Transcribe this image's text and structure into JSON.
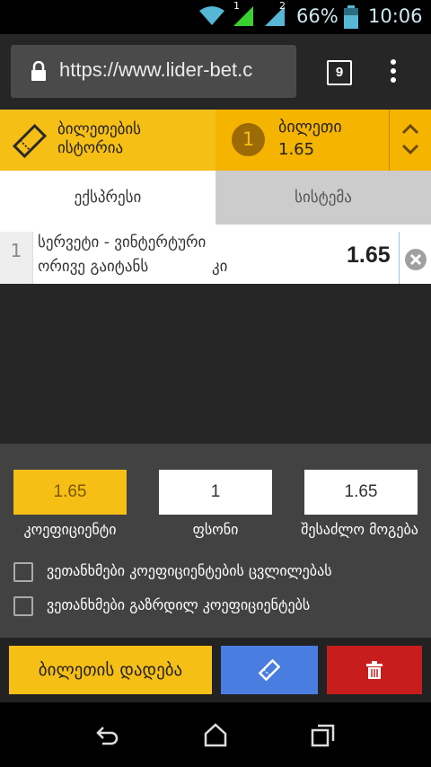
{
  "status_bar": {
    "battery_percent": "66%",
    "time": "10:06",
    "signal_1_label": "1",
    "signal_2_label": "2"
  },
  "browser": {
    "url": "https://www.lider-bet.c",
    "tab_count": "9"
  },
  "header": {
    "history_label": "ბილეთების ისტორია",
    "ticket_count": "1",
    "ticket_title": "ბილეთი",
    "ticket_odds": "1.65"
  },
  "tabs": {
    "express": "ექსპრესი",
    "system": "სისტემა"
  },
  "selection": {
    "index": "1",
    "event": "სერვეტი - ვინტერტური",
    "market": "ორივე გაიტანს",
    "outcome": "კი",
    "odds": "1.65"
  },
  "calculator": {
    "coefficient_value": "1.65",
    "coefficient_label": "კოეფიციენტი",
    "stake_value": "1",
    "stake_label": "ფსონი",
    "possible_win_value": "1.65",
    "possible_win_label": "შესაძლო მოგება",
    "accept_changes_label": "ვეთანხმები კოეფიციენტების ცვლილებას",
    "accept_increased_label": "ვეთანხმები გაზრდილ კოეფიციენტებს"
  },
  "actions": {
    "place_bet_label": "ბილეთის დადება"
  },
  "colors": {
    "accent": "#f6bf16",
    "save": "#4a7de0",
    "delete": "#c81d1d"
  },
  "icons": [
    "wifi-icon",
    "signal-icon",
    "battery-icon",
    "lock-icon",
    "menu-dots-icon",
    "ticket-icon",
    "chevron-up-icon",
    "chevron-down-icon",
    "close-circle-icon",
    "ticket-save-icon",
    "trash-icon",
    "back-icon",
    "home-icon",
    "recents-icon"
  ]
}
